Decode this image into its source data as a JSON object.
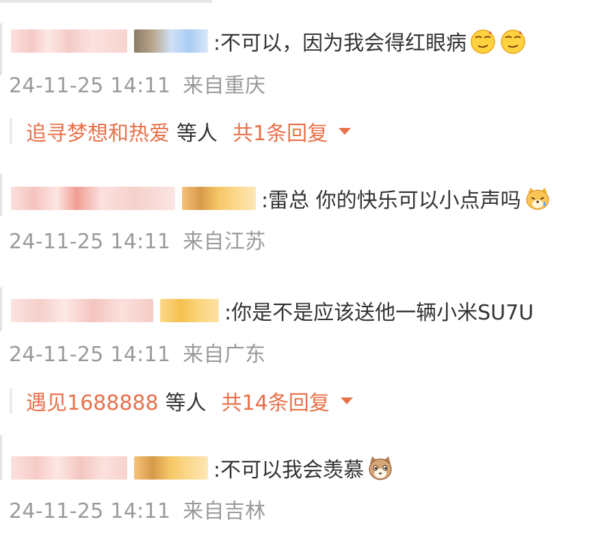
{
  "comments": [
    {
      "text": ":不可以，因为我会得红眼病",
      "timestamp": "24-11-25 14:11",
      "location": "来自重庆",
      "emojis": [
        "smirk-face-icon",
        "smirk-face-icon"
      ],
      "replies": {
        "user": "追寻梦想和热爱",
        "etc": "等人",
        "count": "共1条回复"
      }
    },
    {
      "text": ":雷总 你的快乐可以小点声吗",
      "timestamp": "24-11-25 14:11",
      "location": "来自江苏",
      "emojis": [
        "crying-dog-icon"
      ]
    },
    {
      "text": ":你是不是应该送他一辆小米SU7U",
      "timestamp": "24-11-25 14:11",
      "location": "来自广东",
      "emojis": [],
      "replies": {
        "user": "遇见1688888",
        "etc": "等人",
        "count": "共14条回复"
      }
    },
    {
      "text": ":不可以我会羡慕",
      "timestamp": "24-11-25 14:11",
      "location": "来自吉林",
      "emojis": [
        "envious-cat-icon"
      ]
    }
  ],
  "colors": {
    "accent": "#e8714a",
    "meta_text": "#9a9a9a",
    "body_text": "#333333"
  }
}
